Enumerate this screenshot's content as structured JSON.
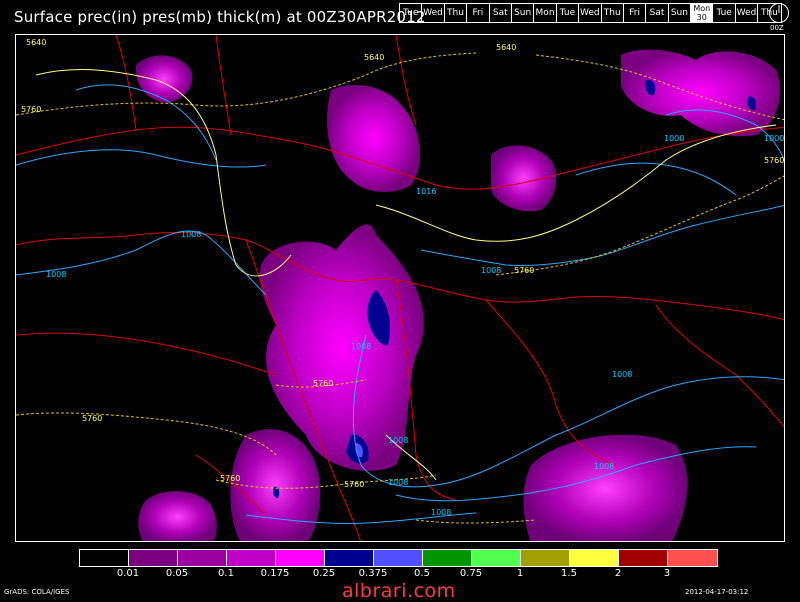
{
  "title": "Surface prec(in) pres(mb) thick(m) at 00Z30APR2012",
  "days": [
    {
      "label": "Tue"
    },
    {
      "label": "Wed"
    },
    {
      "label": "Thu"
    },
    {
      "label": "Fri"
    },
    {
      "label": "Sat"
    },
    {
      "label": "Sun"
    },
    {
      "label": "Mon"
    },
    {
      "label": "Tue"
    },
    {
      "label": "Wed"
    },
    {
      "label": "Thu"
    },
    {
      "label": "Fri"
    },
    {
      "label": "Sat"
    },
    {
      "label": "Sun"
    },
    {
      "label": "Mon",
      "sub": "30",
      "active": true
    },
    {
      "label": "Tue"
    },
    {
      "label": "Wed"
    },
    {
      "label": "Thu"
    }
  ],
  "clock_label": "00Z",
  "colorbar": {
    "colors": [
      "#000000",
      "#7a0080",
      "#9a00a0",
      "#c000c8",
      "#ff00ff",
      "#000090",
      "#5050ff",
      "#009600",
      "#50ff50",
      "#a0a000",
      "#ffff40",
      "#a00000",
      "#ff5050"
    ],
    "ticks": [
      "0.01",
      "0.05",
      "0.1",
      "0.175",
      "0.25",
      "0.375",
      "0.5",
      "0.75",
      "1",
      "1.5",
      "2",
      "3"
    ]
  },
  "contour_labels": {
    "pressure": [
      "1008",
      "1008",
      "1008",
      "1008",
      "1008",
      "1008",
      "1008",
      "1008",
      "1008",
      "1016",
      "1000",
      "1000"
    ],
    "thickness": [
      "5640",
      "5640",
      "5640",
      "5760",
      "5760",
      "5760",
      "5760",
      "5760",
      "5760",
      "5760"
    ]
  },
  "footer": {
    "grads": "GrADS: COLA/IGES",
    "watermark": "albrari.com",
    "timestamp": "2012-04-17-03:12"
  }
}
